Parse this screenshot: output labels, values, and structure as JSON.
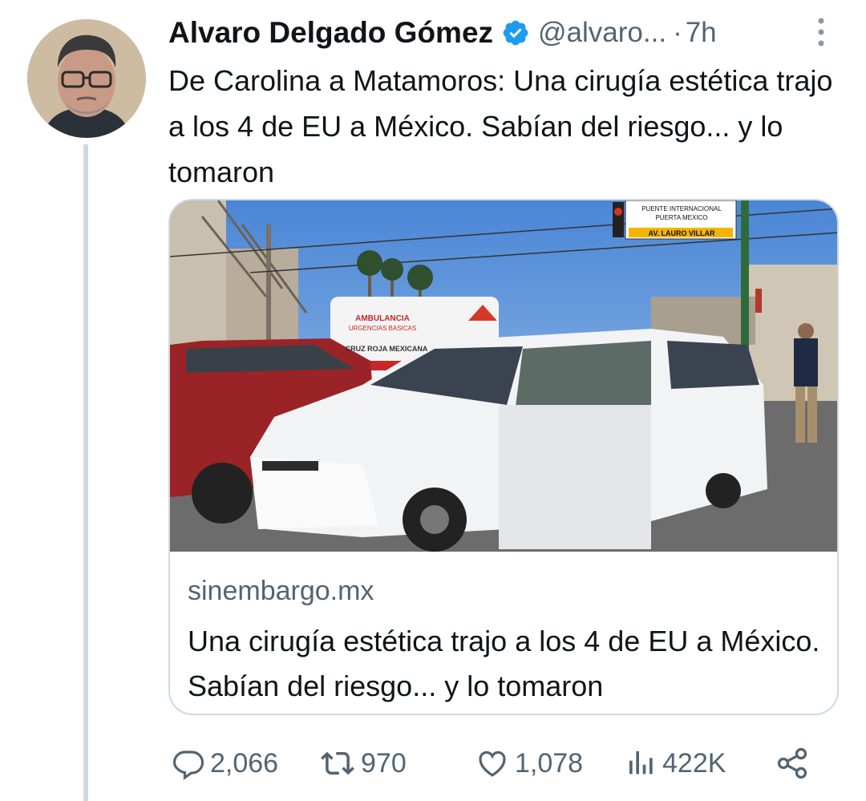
{
  "author": {
    "name": "Alvaro Delgado Gómez",
    "handle": "@alvaro...",
    "separator": "·",
    "time": "7h",
    "verified": true
  },
  "tweet": {
    "text": "De Carolina a Matamoros: Una cirugía estética trajo a los 4 de EU a México. Sabían del riesgo... y lo tomaron"
  },
  "card": {
    "image_sign": {
      "line1": "PUENTE INTERNACIONAL",
      "line2": "PUERTA MEXICO",
      "line3": "AV. LAURO VILLAR"
    },
    "ambulance_text": {
      "line1": "AMBULANCIA",
      "line2": "URGENCIAS BASICAS",
      "line3": "CRUZ ROJA MEXICANA"
    },
    "domain": "sinembargo.mx",
    "title": "Una cirugía estética trajo a los 4 de EU a México. Sabían del riesgo... y lo tomaron"
  },
  "actions": {
    "replies": "2,066",
    "reposts": "970",
    "likes": "1,078",
    "views": "422K"
  },
  "colors": {
    "text_primary": "#0f1419",
    "text_secondary": "#536471",
    "verified_blue": "#1d9bf0",
    "border": "#cfd9de"
  },
  "icons": [
    "verified-badge-icon",
    "more-options-icon",
    "reply-icon",
    "repost-icon",
    "like-icon",
    "views-icon",
    "share-icon"
  ]
}
